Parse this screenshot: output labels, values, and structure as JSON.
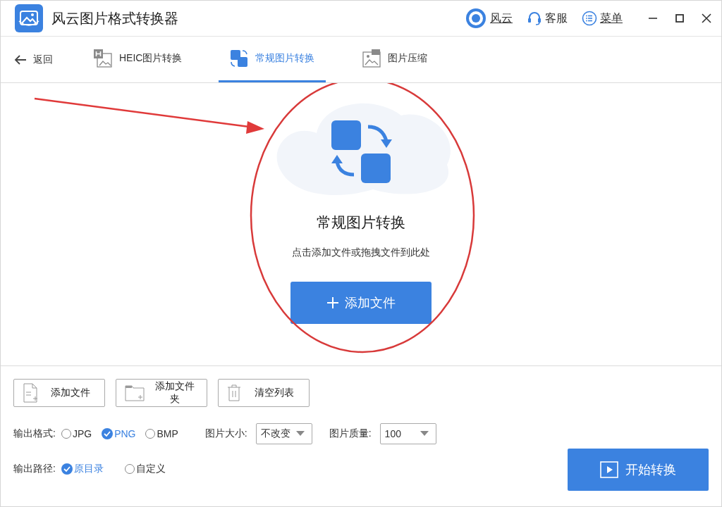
{
  "window": {
    "title": "风云图片格式转换器"
  },
  "header_links": [
    {
      "kind": "account",
      "label": "风云"
    },
    {
      "kind": "support",
      "label": "客服"
    },
    {
      "kind": "menu",
      "label": "菜单"
    }
  ],
  "nav": {
    "back": "返回",
    "tabs": [
      {
        "kind": "heic",
        "label": "HEIC图片转换",
        "selected": false
      },
      {
        "kind": "convert",
        "label": "常规图片转换",
        "selected": true
      },
      {
        "kind": "zip",
        "label": "图片压缩",
        "selected": false
      }
    ]
  },
  "drop_zone": {
    "title": "常规图片转换",
    "hint": "点击添加文件或拖拽文件到此处",
    "button": "添加文件"
  },
  "toolbar": [
    {
      "kind": "file",
      "label": "添加文件"
    },
    {
      "kind": "folder",
      "label": "添加文件夹"
    },
    {
      "kind": "trash",
      "label": "清空列表"
    }
  ],
  "output_format": {
    "label": "输出格式:",
    "options": [
      {
        "label": "JPG",
        "selected": false
      },
      {
        "label": "PNG",
        "selected": true
      },
      {
        "label": "BMP",
        "selected": false
      }
    ]
  },
  "image_size": {
    "label": "图片大小:",
    "value": "不改变"
  },
  "image_quality": {
    "label": "图片质量:",
    "value": "100"
  },
  "output_path": {
    "label": "输出路径:",
    "options": [
      {
        "label": "原目录",
        "selected": true
      },
      {
        "label": "自定义",
        "selected": false
      }
    ]
  },
  "start_button": "开始转换"
}
